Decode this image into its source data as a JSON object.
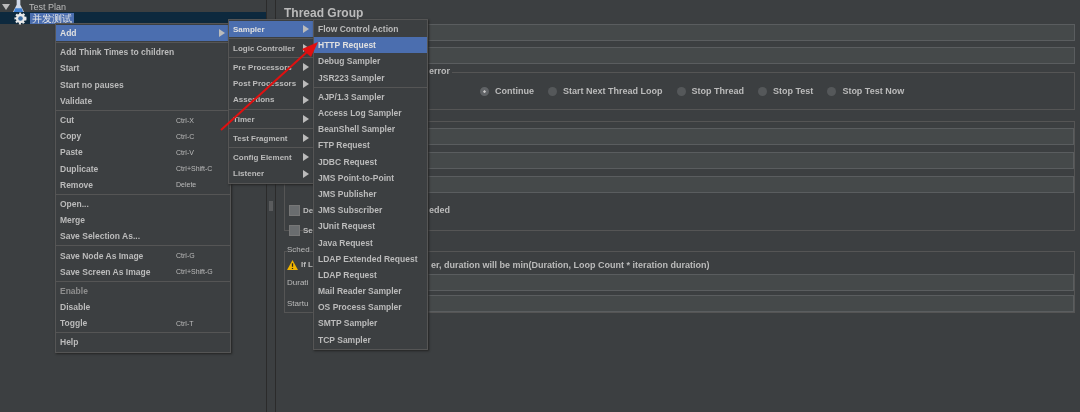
{
  "tree": [
    {
      "label": "Test Plan",
      "expanded": true,
      "selected": false,
      "children": [
        {
          "label": "并发测试",
          "selected": true
        }
      ]
    }
  ],
  "panel": {
    "title": "Thread Group",
    "error_group": {
      "legend": "error",
      "options": [
        {
          "label": "Continue",
          "selected": true
        },
        {
          "label": "Start Next Thread Loop",
          "selected": false
        },
        {
          "label": "Stop Thread",
          "selected": false
        },
        {
          "label": "Stop Test",
          "selected": false
        },
        {
          "label": "Stop Test Now",
          "selected": false
        }
      ]
    },
    "loop_group": {
      "checkboxes": [
        {
          "label": "De",
          "tail": "eded",
          "checked": false
        },
        {
          "label": "Se",
          "checked": false
        }
      ]
    },
    "scheduler": {
      "legend": "Sched",
      "warning_head": "If L",
      "warning_tail": "er, duration will be min(Duration, Loop Count * iteration duration)",
      "rows": [
        {
          "label": "Durati"
        },
        {
          "label": "Startu"
        }
      ]
    }
  },
  "context_menu": {
    "groups": [
      [
        {
          "label": "Add",
          "submenu": true,
          "selected": true,
          "disabled": false
        }
      ],
      [
        {
          "label": "Add Think Times to children",
          "submenu": false,
          "selected": false,
          "disabled": false
        },
        {
          "label": "Start",
          "submenu": false,
          "selected": false,
          "disabled": false
        },
        {
          "label": "Start no pauses",
          "submenu": false,
          "selected": false,
          "disabled": false
        },
        {
          "label": "Validate",
          "submenu": false,
          "selected": false,
          "disabled": false
        }
      ],
      [
        {
          "label": "Cut",
          "shortcut": "Ctrl-X",
          "submenu": false,
          "selected": false,
          "disabled": false
        },
        {
          "label": "Copy",
          "shortcut": "Ctrl-C",
          "submenu": false,
          "selected": false,
          "disabled": false
        },
        {
          "label": "Paste",
          "shortcut": "Ctrl-V",
          "submenu": false,
          "selected": false,
          "disabled": false
        },
        {
          "label": "Duplicate",
          "shortcut": "Ctrl+Shift-C",
          "submenu": false,
          "selected": false,
          "disabled": false
        },
        {
          "label": "Remove",
          "shortcut": "Delete",
          "submenu": false,
          "selected": false,
          "disabled": false
        }
      ],
      [
        {
          "label": "Open...",
          "submenu": false,
          "selected": false,
          "disabled": false
        },
        {
          "label": "Merge",
          "submenu": false,
          "selected": false,
          "disabled": false
        },
        {
          "label": "Save Selection As...",
          "submenu": false,
          "selected": false,
          "disabled": false
        }
      ],
      [
        {
          "label": "Save Node As Image",
          "shortcut": "Ctrl-G",
          "submenu": false,
          "selected": false,
          "disabled": false
        },
        {
          "label": "Save Screen As Image",
          "shortcut": "Ctrl+Shift-G",
          "submenu": false,
          "selected": false,
          "disabled": false
        }
      ],
      [
        {
          "label": "Enable",
          "submenu": false,
          "selected": false,
          "disabled": true
        },
        {
          "label": "Disable",
          "submenu": false,
          "selected": false,
          "disabled": false
        },
        {
          "label": "Toggle",
          "shortcut": "Ctrl-T",
          "submenu": false,
          "selected": false,
          "disabled": false
        }
      ],
      [
        {
          "label": "Help",
          "submenu": false,
          "selected": false,
          "disabled": false
        }
      ]
    ]
  },
  "add_menu": {
    "groups": [
      [
        {
          "label": "Sampler",
          "submenu": true,
          "selected": true,
          "disabled": false
        }
      ],
      [
        {
          "label": "Logic Controller",
          "submenu": true,
          "selected": false,
          "disabled": false
        }
      ],
      [
        {
          "label": "Pre Processors",
          "submenu": true,
          "selected": false,
          "disabled": false
        },
        {
          "label": "Post Processors",
          "submenu": true,
          "selected": false,
          "disabled": false
        },
        {
          "label": "Assertions",
          "submenu": true,
          "selected": false,
          "disabled": false
        }
      ],
      [
        {
          "label": "Timer",
          "submenu": true,
          "selected": false,
          "disabled": false
        }
      ],
      [
        {
          "label": "Test Fragment",
          "submenu": true,
          "selected": false,
          "disabled": false
        }
      ],
      [
        {
          "label": "Config Element",
          "submenu": true,
          "selected": false,
          "disabled": false
        },
        {
          "label": "Listener",
          "submenu": true,
          "selected": false,
          "disabled": false
        }
      ]
    ]
  },
  "sampler_menu": {
    "groups": [
      [
        {
          "label": "Flow Control Action",
          "submenu": false,
          "selected": false,
          "disabled": false
        },
        {
          "label": "HTTP Request",
          "submenu": false,
          "selected": true,
          "disabled": false
        },
        {
          "label": "Debug Sampler",
          "submenu": false,
          "selected": false,
          "disabled": false
        },
        {
          "label": "JSR223 Sampler",
          "submenu": false,
          "selected": false,
          "disabled": false
        }
      ],
      [
        {
          "label": "AJP/1.3 Sampler",
          "submenu": false,
          "selected": false,
          "disabled": false
        },
        {
          "label": "Access Log Sampler",
          "submenu": false,
          "selected": false,
          "disabled": false
        },
        {
          "label": "BeanShell Sampler",
          "submenu": false,
          "selected": false,
          "disabled": false
        },
        {
          "label": "FTP Request",
          "submenu": false,
          "selected": false,
          "disabled": false
        },
        {
          "label": "JDBC Request",
          "submenu": false,
          "selected": false,
          "disabled": false
        },
        {
          "label": "JMS Point-to-Point",
          "submenu": false,
          "selected": false,
          "disabled": false
        },
        {
          "label": "JMS Publisher",
          "submenu": false,
          "selected": false,
          "disabled": false
        },
        {
          "label": "JMS Subscriber",
          "submenu": false,
          "selected": false,
          "disabled": false
        },
        {
          "label": "JUnit Request",
          "submenu": false,
          "selected": false,
          "disabled": false
        },
        {
          "label": "Java Request",
          "submenu": false,
          "selected": false,
          "disabled": false
        },
        {
          "label": "LDAP Extended Request",
          "submenu": false,
          "selected": false,
          "disabled": false
        },
        {
          "label": "LDAP Request",
          "submenu": false,
          "selected": false,
          "disabled": false
        },
        {
          "label": "Mail Reader Sampler",
          "submenu": false,
          "selected": false,
          "disabled": false
        },
        {
          "label": "OS Process Sampler",
          "submenu": false,
          "selected": false,
          "disabled": false
        },
        {
          "label": "SMTP Sampler",
          "submenu": false,
          "selected": false,
          "disabled": false
        },
        {
          "label": "TCP Sampler",
          "submenu": false,
          "selected": false,
          "disabled": false
        }
      ]
    ]
  }
}
